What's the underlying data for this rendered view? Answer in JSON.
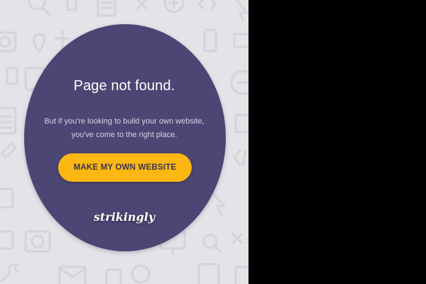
{
  "page": {
    "background_color": "#e3e4e8",
    "outside_area_color": "#000000"
  },
  "error_card": {
    "color": "#4b4673",
    "headline": "Page not found.",
    "message_line_1": "But if you're looking to build your own website,",
    "message_line_2": "you've come to the right place.",
    "cta_label": "MAKE MY OWN WEBSITE",
    "cta_color": "#fcb713",
    "brand_name": "strikingly"
  },
  "background_icons": [
    "search-icon",
    "phone-icon",
    "document-icon",
    "close-icon",
    "zoom-icon",
    "camera-icon",
    "location-pin-icon",
    "image-icon",
    "monitor-icon",
    "clipboard-icon",
    "minus-circle-icon",
    "code-icon",
    "paint-bucket-icon",
    "pointer-icon",
    "trash-icon",
    "envelope-icon",
    "wrench-icon"
  ]
}
